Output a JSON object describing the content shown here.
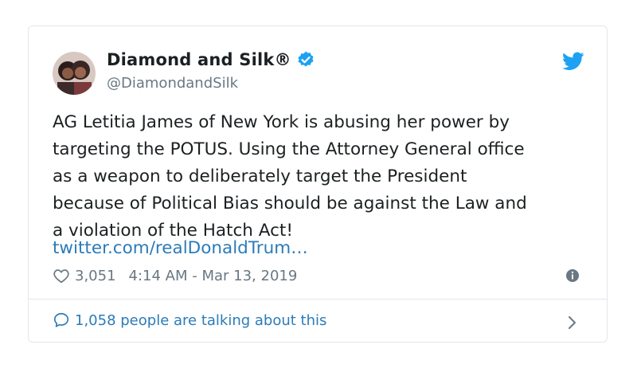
{
  "tweet": {
    "display_name": "Diamond and Silk®",
    "handle": "@DiamondandSilk",
    "text": "AG Letitia James of New York is abusing her power by\ntargeting the POTUS.  Using the Attorney General office\nas a weapon to deliberately target the President\nbecause of Political Bias should be against the Law and\na violation of the Hatch Act!",
    "link": "twitter.com/realDonaldTrum…",
    "likes": "3,051",
    "timestamp": "4:14 AM - Mar 13, 2019",
    "talking": "1,058 people are talking about this"
  },
  "icons": {
    "verified": "verified-badge-icon",
    "bird": "twitter-bird-icon",
    "heart": "heart-outline-icon",
    "info": "info-icon",
    "bubble": "speech-bubble-icon",
    "chevron": "chevron-right-icon"
  },
  "colors": {
    "accent": "#1da1f2",
    "link": "#2b7bb9",
    "muted": "#697882",
    "text": "#1c2022"
  }
}
